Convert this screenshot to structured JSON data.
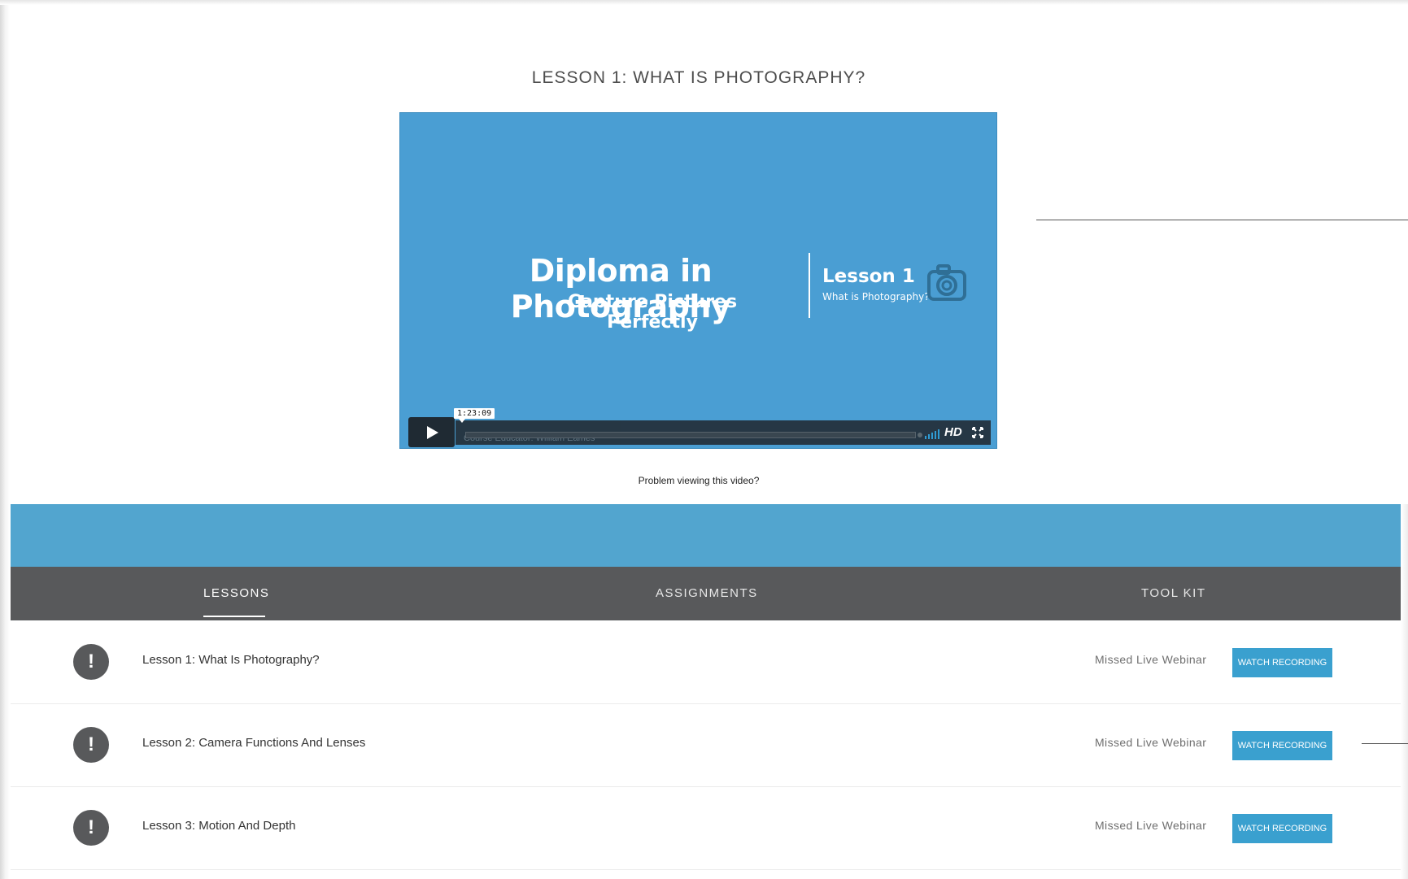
{
  "lesson_heading": "LESSON 1: WHAT IS PHOTOGRAPHY?",
  "video": {
    "slide_title": "Diploma in Photography",
    "slide_subtitle": "Capture Pictures Perfectly",
    "slide_lesson": "Lesson 1",
    "slide_lesson_sub": "What is Photography?",
    "caption": "Course Educator: William Eames",
    "time": "1:23:09",
    "quality": "HD"
  },
  "problem_link": "Problem viewing this video?",
  "tabs": [
    {
      "label": "LESSONS",
      "active": true
    },
    {
      "label": "ASSIGNMENTS",
      "active": false
    },
    {
      "label": "TOOL KIT",
      "active": false
    }
  ],
  "lessons": [
    {
      "title": "Lesson 1: What Is Photography?",
      "status": "Missed Live Webinar",
      "button": "WATCH RECORDING"
    },
    {
      "title": "Lesson 2: Camera Functions And Lenses",
      "status": "Missed Live Webinar",
      "button": "WATCH RECORDING"
    },
    {
      "title": "Lesson 3: Motion And Depth",
      "status": "Missed Live Webinar",
      "button": "WATCH RECORDING"
    }
  ],
  "alert_symbol": "!",
  "colors": {
    "accent": "#3aa0cf",
    "band": "#52a5cf",
    "tabbar": "#58595b",
    "video_bg": "#4a9ed3"
  }
}
